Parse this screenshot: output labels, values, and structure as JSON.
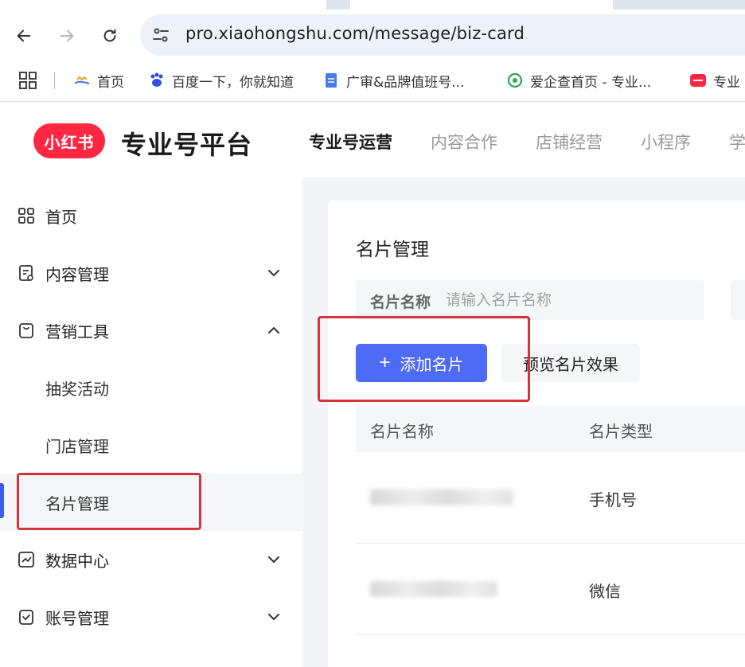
{
  "browser": {
    "url": "pro.xiaohongshu.com/message/biz-card",
    "bookmarks": [
      {
        "label": "首页",
        "icon": "home-bookmark-icon"
      },
      {
        "label": "百度一下，你就知道",
        "icon": "baidu-paw-icon"
      },
      {
        "label": "广审&品牌值班号...",
        "icon": "doc-icon"
      },
      {
        "label": "爱企查首页 - 专业...",
        "icon": "aiqicha-icon"
      },
      {
        "label": "专业",
        "icon": "xiaohongshu-icon"
      }
    ]
  },
  "header": {
    "logo_text": "小红书",
    "brand": "专业号平台",
    "nav": [
      "专业号运营",
      "内容合作",
      "店铺经营",
      "小程序",
      "学"
    ]
  },
  "sidebar": {
    "items": [
      {
        "label": "首页",
        "icon": "grid-icon"
      },
      {
        "label": "内容管理",
        "icon": "content-icon"
      },
      {
        "label": "营销工具",
        "icon": "bag-icon"
      },
      {
        "label": "抽奖活动"
      },
      {
        "label": "门店管理"
      },
      {
        "label": "名片管理"
      },
      {
        "label": "数据中心",
        "icon": "chart-icon"
      },
      {
        "label": "账号管理",
        "icon": "account-icon"
      }
    ]
  },
  "main": {
    "title": "名片管理",
    "filter": {
      "label": "名片名称",
      "placeholder": "请输入名片名称"
    },
    "add_button": "添加名片",
    "preview_button": "预览名片效果",
    "table": {
      "columns": [
        "名片名称",
        "名片类型"
      ],
      "rows": [
        {
          "type": "手机号"
        },
        {
          "type": "微信"
        }
      ]
    }
  },
  "colors": {
    "brand_red": "#ff2741",
    "primary_blue": "#4d6bf5",
    "highlight_red": "#d4333c"
  }
}
